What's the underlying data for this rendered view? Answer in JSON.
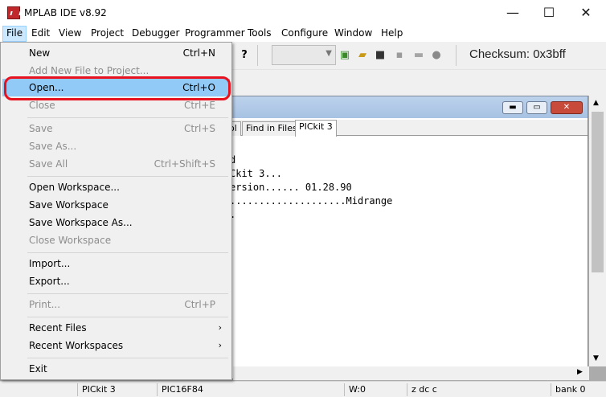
{
  "window": {
    "title": "MPLAB IDE v8.92",
    "minimize": "—",
    "maximize": "☐",
    "close": "✕"
  },
  "menubar": {
    "items": [
      "File",
      "Edit",
      "View",
      "Project",
      "Debugger",
      "Programmer",
      "Tools",
      "Configure",
      "Window",
      "Help"
    ]
  },
  "toolbar": {
    "help": "?",
    "checksum": "Checksum:  0x3bff"
  },
  "output_window": {
    "tabs": [
      "ol",
      "Find in Files",
      "PICkit 3"
    ],
    "selected_tab": "PICkit 3",
    "lines": [
      "d",
      "Ckit 3...",
      "ersion...... 01.28.90",
      "....................Midrange",
      "."
    ]
  },
  "statusbar": {
    "tool": "PICkit 3",
    "device": "PIC16F84",
    "w": "W:0",
    "flags": "z dc c",
    "bank": "bank 0"
  },
  "file_menu": {
    "items": [
      {
        "label": "New",
        "shortcut": "Ctrl+N",
        "enabled": true
      },
      {
        "label": "Add New File to Project...",
        "shortcut": "",
        "enabled": false
      },
      {
        "label": "Open...",
        "shortcut": "Ctrl+O",
        "enabled": true,
        "highlighted": true
      },
      {
        "label": "Close",
        "shortcut": "Ctrl+E",
        "enabled": false
      },
      {
        "label": "Save",
        "shortcut": "Ctrl+S",
        "enabled": false
      },
      {
        "label": "Save As...",
        "shortcut": "",
        "enabled": false
      },
      {
        "label": "Save All",
        "shortcut": "Ctrl+Shift+S",
        "enabled": false
      },
      {
        "label": "Open Workspace...",
        "shortcut": "",
        "enabled": true
      },
      {
        "label": "Save Workspace",
        "shortcut": "",
        "enabled": true
      },
      {
        "label": "Save Workspace As...",
        "shortcut": "",
        "enabled": true
      },
      {
        "label": "Close Workspace",
        "shortcut": "",
        "enabled": false
      },
      {
        "label": "Import...",
        "shortcut": "",
        "enabled": true
      },
      {
        "label": "Export...",
        "shortcut": "",
        "enabled": true
      },
      {
        "label": "Print...",
        "shortcut": "Ctrl+P",
        "enabled": false
      },
      {
        "label": "Recent Files",
        "shortcut": "›",
        "enabled": true
      },
      {
        "label": "Recent Workspaces",
        "shortcut": "›",
        "enabled": true
      },
      {
        "label": "Exit",
        "shortcut": "",
        "enabled": true
      }
    ]
  },
  "colors": {
    "highlight": "#91c9f7",
    "annotation_ring": "#e8121e",
    "menu_active": "#cce8ff"
  }
}
